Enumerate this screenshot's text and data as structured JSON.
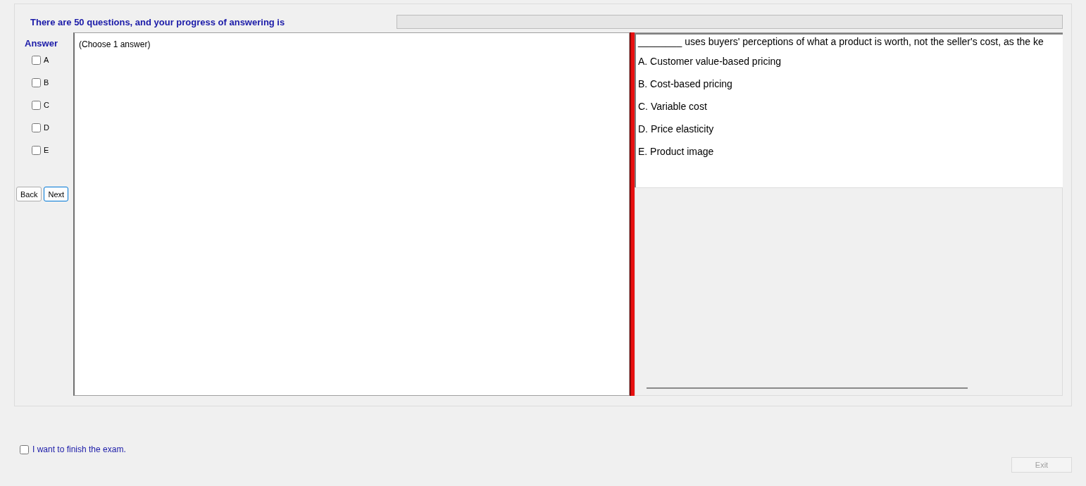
{
  "header": {
    "text": "There are 50 questions, and your progress of answering is",
    "progress": {
      "level": 0
    }
  },
  "answer": {
    "title": "Answer",
    "options": [
      {
        "label": "A",
        "checked": false
      },
      {
        "label": "B",
        "checked": false
      },
      {
        "label": "C",
        "checked": false
      },
      {
        "label": "D",
        "checked": false
      },
      {
        "label": "E",
        "checked": false
      }
    ],
    "buttons": [
      {
        "label": "Back",
        "selected": false
      },
      {
        "label": "Next",
        "selected": true
      }
    ]
  },
  "answer_area": {
    "hint": "(Choose 1 answer)"
  },
  "question": {
    "text": "________ uses buyers' perceptions of what a product is worth, not the seller's cost, as the ke",
    "choices": [
      "A.  Customer value-based pricing",
      "B.  Cost-based pricing",
      "C.  Variable cost",
      "D.  Price elasticity",
      "E.  Product image"
    ]
  },
  "finish": {
    "label": "I want to finish the exam.",
    "checked": false
  },
  "exit": {
    "label": "Exit",
    "disabled": true
  }
}
